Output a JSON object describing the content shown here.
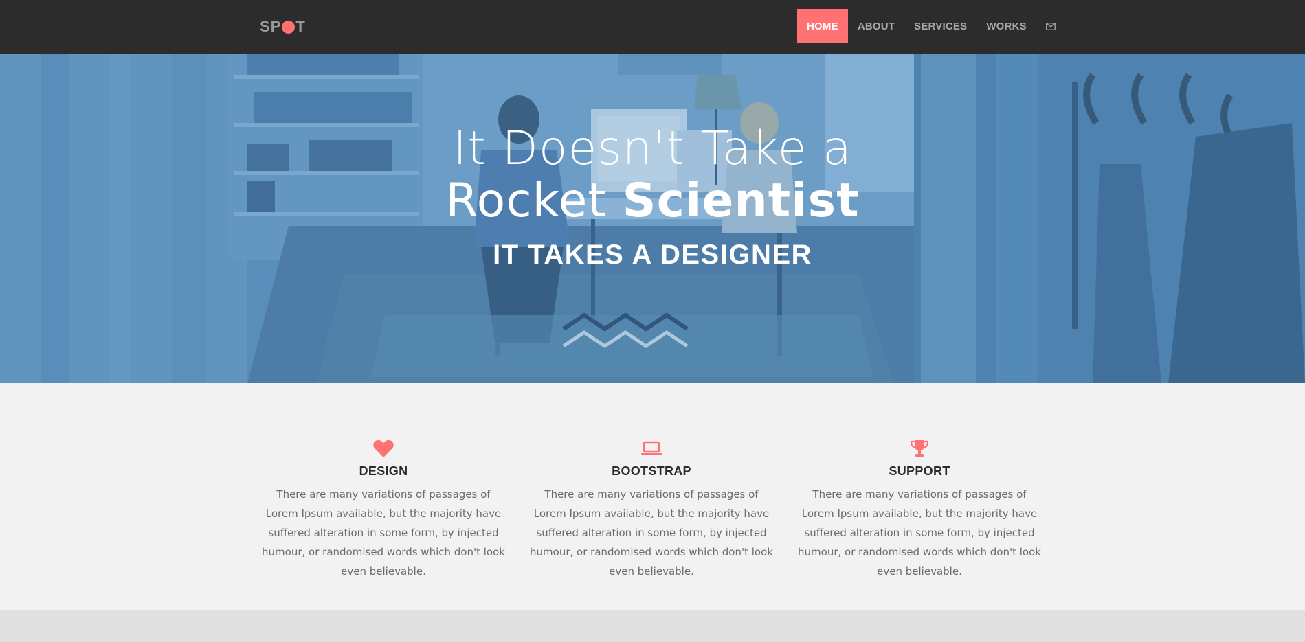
{
  "brand": {
    "logo_text_left": "SP",
    "logo_text_right": "T"
  },
  "nav": {
    "items": [
      {
        "label": "HOME",
        "active": true
      },
      {
        "label": "ABOUT",
        "active": false
      },
      {
        "label": "SERVICES",
        "active": false
      },
      {
        "label": "WORKS",
        "active": false
      }
    ],
    "mail_icon": "envelope-icon"
  },
  "hero": {
    "title_line1": "It Doesn't Take a",
    "title_line2_light": "Rocket ",
    "title_line2_bold": "Scientist",
    "subtitle": "IT TAKES A DESIGNER"
  },
  "features": [
    {
      "icon": "heart-icon",
      "title": "DESIGN",
      "text": "There are many variations of passages of Lorem Ipsum available, but the majority have suffered alteration in some form, by injected humour, or randomised words which don't look even believable."
    },
    {
      "icon": "laptop-icon",
      "title": "BOOTSTRAP",
      "text": "There are many variations of passages of Lorem Ipsum available, but the majority have suffered alteration in some form, by injected humour, or randomised words which don't look even believable."
    },
    {
      "icon": "trophy-icon",
      "title": "SUPPORT",
      "text": "There are many variations of passages of Lorem Ipsum available, but the majority have suffered alteration in some form, by injected humour, or randomised words which don't look even believable."
    }
  ],
  "colors": {
    "accent": "#ff7173",
    "navbar_bg": "#2c2c2c",
    "hero_tint": "#5e8fb8",
    "features_bg": "#f2f2f2"
  }
}
